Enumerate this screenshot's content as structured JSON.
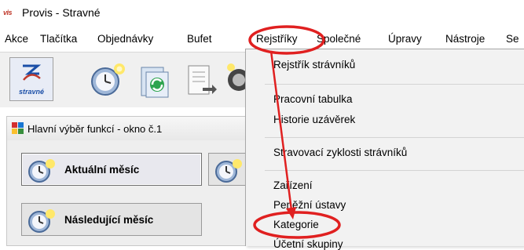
{
  "window": {
    "logo_text": "vis",
    "title": "Provis - Stravné"
  },
  "menubar": {
    "items": [
      {
        "label": "Akce"
      },
      {
        "label": "Tlačítka"
      },
      {
        "label": "Objednávky"
      },
      {
        "label": "Bufet"
      },
      {
        "label": "Rejstříky"
      },
      {
        "label": "Společné"
      },
      {
        "label": "Úpravy"
      },
      {
        "label": "Nástroje"
      },
      {
        "label": "Se"
      }
    ]
  },
  "toolbar": {
    "main_button_label": "stravné",
    "icons": [
      "clock-star-icon",
      "refresh-green-icon",
      "document-arrow-icon",
      "tool-icon"
    ]
  },
  "inner_window": {
    "title": "Hlavní výběr funkcí - okno č.1",
    "buttons": [
      {
        "label": "Aktuální měsíc"
      },
      {
        "label": "Následující měsíc"
      }
    ]
  },
  "dropdown": {
    "items": [
      {
        "label": "Rejstřík strávníků"
      },
      {
        "label": "Pracovní tabulka"
      },
      {
        "label": "Historie uzávěrek"
      },
      {
        "label": "Stravovací zyklosti strávníků"
      },
      {
        "label": "Zařízení"
      },
      {
        "label": "Peněžní ústavy"
      },
      {
        "label": "Kategorie"
      },
      {
        "label": "Účetní skupiny"
      }
    ]
  },
  "colors": {
    "annotation": "#e02020",
    "menu_bg": "#f2f2f2",
    "accent": "#1b4fa8"
  }
}
